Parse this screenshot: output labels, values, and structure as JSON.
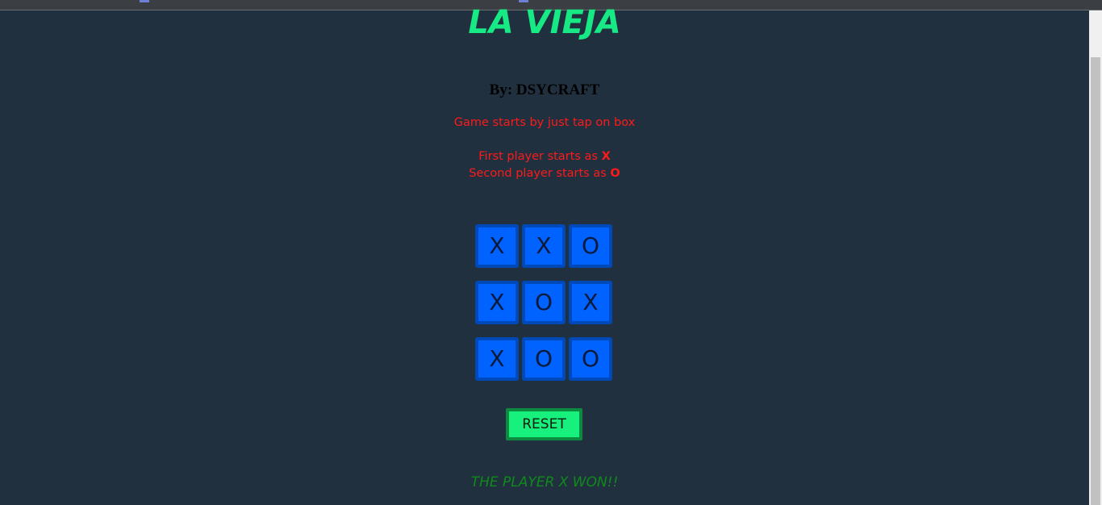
{
  "game": {
    "title": "LA VIEJA",
    "author": "By: DSYCRAFT",
    "instructions": {
      "start_line": "Game starts by just tap on box",
      "first_player_prefix": "First player starts as",
      "first_player_mark": "X",
      "second_player_prefix": "Second player starts as",
      "second_player_mark": "O"
    },
    "board": [
      [
        "X",
        "X",
        "O"
      ],
      [
        "X",
        "O",
        "X"
      ],
      [
        "X",
        "O",
        "O"
      ]
    ],
    "reset_label": "RESET",
    "result": "THE PLAYER X WON!!"
  },
  "colors": {
    "background": "#20303f",
    "title": "#17e985",
    "instructions": "#ff1a1a",
    "cell_fill": "#0062ff",
    "cell_border": "#0049b8",
    "reset_fill": "#17f07c",
    "reset_border": "#0b8a40",
    "result": "#0f8a1b"
  }
}
